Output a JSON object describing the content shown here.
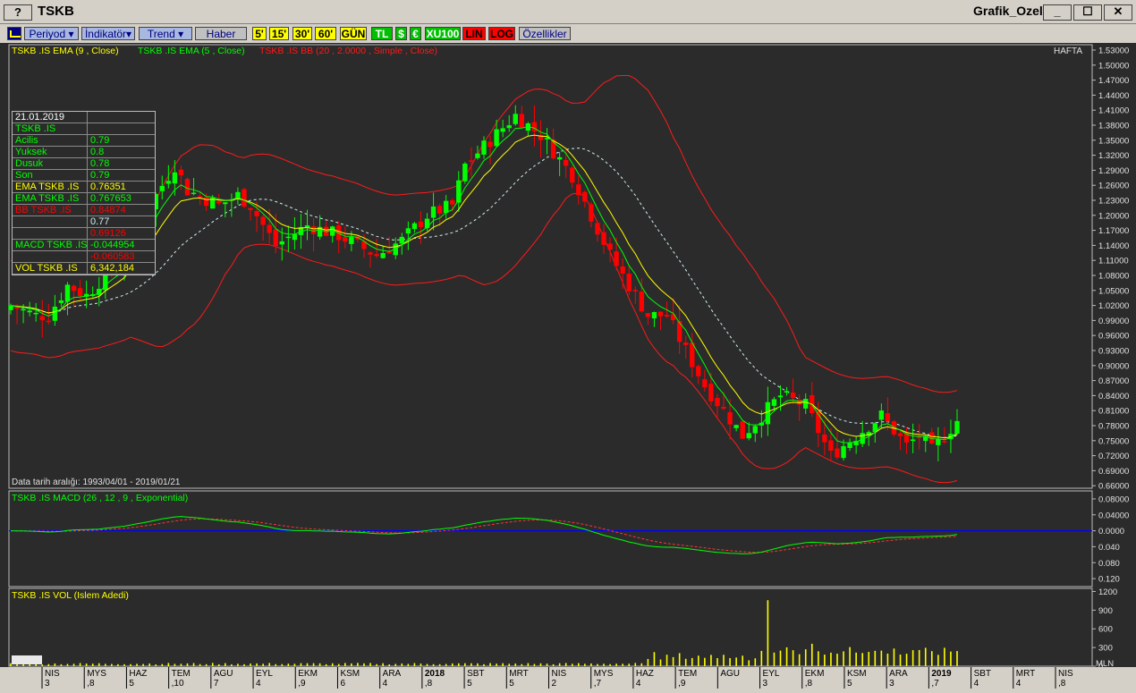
{
  "window": {
    "help_label": "?",
    "title": "TSKB",
    "grafik_label": "Grafik_Ozel",
    "min_label": "_",
    "max_label": "☐",
    "close_label": "✕"
  },
  "toolbar": {
    "icon": "chart-icon",
    "buttons": [
      {
        "label": "Periyod ▾",
        "style": "tblue"
      },
      {
        "label": "İndikatör▾",
        "style": "tblue"
      },
      {
        "label": "Trend ▾",
        "style": "tblue"
      },
      {
        "label": "Haber",
        "style": "tgray"
      },
      {
        "label": "5'",
        "style": "tyellow"
      },
      {
        "label": "15'",
        "style": "tyellow"
      },
      {
        "label": "30'",
        "style": "tyellow"
      },
      {
        "label": "60'",
        "style": "tyellow"
      },
      {
        "label": "GÜN",
        "style": "tyellow"
      },
      {
        "label": "TL",
        "style": "tgreen"
      },
      {
        "label": "$",
        "style": "tgreen"
      },
      {
        "label": "€",
        "style": "tgreen"
      },
      {
        "label": "XU100",
        "style": "tgreen"
      },
      {
        "label": "LIN",
        "style": "tred"
      },
      {
        "label": "LOG",
        "style": "tred"
      },
      {
        "label": "Özellikler",
        "style": "tgray"
      }
    ]
  },
  "colors": {
    "background": "#2b2b2b",
    "up": "#00ff00",
    "down": "#ff0000",
    "ema9": "#ffff00",
    "ema5": "#00ff00",
    "bb": "#ff1a1a",
    "bb_mid": "#cfeff5",
    "macd": "#00ff00",
    "signal": "#ff3333",
    "zero": "#0000ff",
    "vol": "#ffff00"
  },
  "price_panel": {
    "legend_ema9": "TSKB .IS EMA (9 , Close)",
    "legend_ema5": "TSKB .IS EMA (5 , Close)",
    "legend_bb": "TSKB .IS BB (20 , 2.0000 , Simple , Close)",
    "period_label": "HAFTA",
    "date_range": "Data tarih aralığı: 1993/04/01 - 2019/01/21"
  },
  "infobox": [
    {
      "label": "21.01.2019",
      "value": "",
      "lc": "#ffffff",
      "vc": "#ffffff"
    },
    {
      "label": "TSKB .IS",
      "value": "",
      "lc": "#00ff00",
      "vc": "#00ff00"
    },
    {
      "label": " Acilis",
      "value": "0.79",
      "lc": "#00ff00",
      "vc": "#00ff00"
    },
    {
      "label": " Yuksek",
      "value": "0.8",
      "lc": "#00ff00",
      "vc": "#00ff00"
    },
    {
      "label": " Dusuk",
      "value": "0.78",
      "lc": "#00ff00",
      "vc": "#00ff00"
    },
    {
      "label": " Son",
      "value": "0.79",
      "lc": "#00ff00",
      "vc": "#00ff00"
    },
    {
      "label": "EMA TSKB .IS",
      "value": "0.76351",
      "lc": "#ffff00",
      "vc": "#ffff00"
    },
    {
      "label": "EMA TSKB .IS",
      "value": "0.767653",
      "lc": "#00ff00",
      "vc": "#00ff00"
    },
    {
      "label": "BB TSKB .IS",
      "value": "0.84874",
      "lc": "#ff0000",
      "vc": "#ff0000"
    },
    {
      "label": "",
      "value": "0.77",
      "lc": "#cfeff5",
      "vc": "#cfeff5"
    },
    {
      "label": "",
      "value": "0.69126",
      "lc": "#ff0000",
      "vc": "#ff0000"
    },
    {
      "label": "MACD TSKB .IS",
      "value": "-0.044954",
      "lc": "#00ff00",
      "vc": "#00ff00"
    },
    {
      "label": "",
      "value": "-0.060583",
      "lc": "#ff0000",
      "vc": "#ff0000"
    },
    {
      "label": "VOL TSKB .IS",
      "value": "6,342,184",
      "lc": "#ffff00",
      "vc": "#ffff00"
    }
  ],
  "macd_panel": {
    "legend": "TSKB .IS MACD (26 , 12 , 9 , Exponential)"
  },
  "vol_panel": {
    "legend": "TSKB .IS VOL (Islem Adedi)",
    "unit": "MLN"
  },
  "chart_data": {
    "type": "candlestick",
    "ylim": [
      0.655,
      1.53
    ],
    "price_ticks": [
      1.53,
      1.5,
      1.47,
      1.44,
      1.41,
      1.38,
      1.35,
      1.32,
      1.29,
      1.26,
      1.23,
      1.2,
      1.17,
      1.14,
      1.11,
      1.08,
      1.05,
      1.02,
      0.99,
      0.96,
      0.93,
      0.9,
      0.87,
      0.84,
      0.81,
      0.78,
      0.75,
      0.72,
      0.69,
      0.66
    ],
    "macd_ticks": [
      {
        "v": 0.08,
        "label": "0.08000"
      },
      {
        "v": 0.04,
        "label": "0.04000"
      },
      {
        "v": 0.0,
        "label": "0.0000"
      },
      {
        "v": -0.04,
        "label": "0.040"
      },
      {
        "v": -0.08,
        "label": "0.080"
      },
      {
        "v": -0.12,
        "label": "0.120"
      }
    ],
    "macd_ylim": [
      -0.14,
      0.1
    ],
    "vol_ticks": [
      1200,
      900,
      600,
      300,
      0
    ],
    "vol_ylim": [
      0,
      1250
    ],
    "x_axis": [
      {
        "top": "NIS",
        "bot": "3"
      },
      {
        "top": "MYS",
        "bot": ",8"
      },
      {
        "top": "HAZ",
        "bot": "5"
      },
      {
        "top": "TEM",
        "bot": ",10"
      },
      {
        "top": "AGU",
        "bot": "7"
      },
      {
        "top": "EYL",
        "bot": "4"
      },
      {
        "top": "EKM",
        "bot": ",9"
      },
      {
        "top": "KSM",
        "bot": "6"
      },
      {
        "top": "ARA",
        "bot": "4"
      },
      {
        "top": "2018",
        "bot": ",8",
        "bold": true
      },
      {
        "top": "SBT",
        "bot": "5"
      },
      {
        "top": "MRT",
        "bot": "5"
      },
      {
        "top": "NIS",
        "bot": "2"
      },
      {
        "top": "MYS",
        "bot": ",7"
      },
      {
        "top": "HAZ",
        "bot": "4"
      },
      {
        "top": "TEM",
        "bot": ",9"
      },
      {
        "top": "AGU",
        "bot": ""
      },
      {
        "top": "EYL",
        "bot": "3"
      },
      {
        "top": "EKM",
        "bot": ",8"
      },
      {
        "top": "KSM",
        "bot": "5"
      },
      {
        "top": "ARA",
        "bot": "3"
      },
      {
        "top": "2019",
        "bot": ",7",
        "bold": true
      },
      {
        "top": "SBT",
        "bot": "4"
      },
      {
        "top": "MRT",
        "bot": "4"
      },
      {
        "top": "NIS",
        "bot": ",8"
      }
    ],
    "anchors": [
      [
        0,
        1.02
      ],
      [
        4,
        1.0
      ],
      [
        6,
        1.0
      ],
      [
        9,
        1.06
      ],
      [
        12,
        1.04
      ],
      [
        18,
        1.12
      ],
      [
        22,
        1.22
      ],
      [
        26,
        1.3
      ],
      [
        28,
        1.25
      ],
      [
        33,
        1.22
      ],
      [
        36,
        1.24
      ],
      [
        38,
        1.22
      ],
      [
        42,
        1.14
      ],
      [
        47,
        1.18
      ],
      [
        52,
        1.16
      ],
      [
        58,
        1.12
      ],
      [
        62,
        1.15
      ],
      [
        66,
        1.2
      ],
      [
        70,
        1.22
      ],
      [
        72,
        1.3
      ],
      [
        76,
        1.35
      ],
      [
        80,
        1.4
      ],
      [
        84,
        1.36
      ],
      [
        89,
        1.28
      ],
      [
        95,
        1.12
      ],
      [
        101,
        1.0
      ],
      [
        104,
        1.0
      ],
      [
        110,
        0.86
      ],
      [
        116,
        0.76
      ],
      [
        119,
        0.8
      ],
      [
        122,
        0.84
      ],
      [
        126,
        0.82
      ],
      [
        130,
        0.72
      ],
      [
        134,
        0.76
      ],
      [
        138,
        0.8
      ],
      [
        142,
        0.74
      ],
      [
        144,
        0.76
      ],
      [
        146,
        0.73
      ],
      [
        150,
        0.79
      ]
    ],
    "candle_count": 151
  }
}
